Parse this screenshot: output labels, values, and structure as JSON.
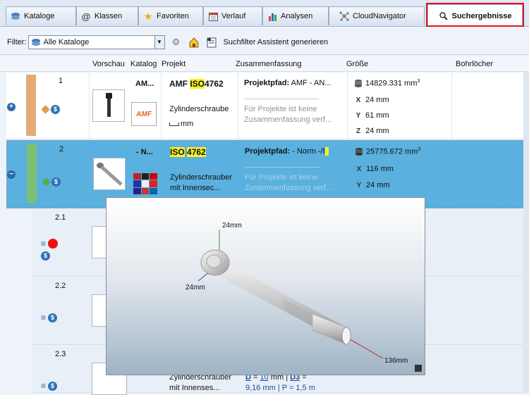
{
  "tabs": [
    {
      "label": "Kataloge",
      "icon": "catalog-stack-icon"
    },
    {
      "label": "Klassen",
      "icon": "at-sign-icon"
    },
    {
      "label": "Favoriten",
      "icon": "star-icon"
    },
    {
      "label": "Verlauf",
      "icon": "calendar-icon"
    },
    {
      "label": "Analysen",
      "icon": "bar-chart-icon"
    },
    {
      "label": "CloudNavigator",
      "icon": "cloud-network-icon"
    },
    {
      "label": "Suchergebnisse",
      "icon": "magnifier-icon",
      "active": true
    }
  ],
  "toolbar": {
    "filter_label": "Filter:",
    "filter_value": "Alle Kataloge",
    "generate_label": "Suchfilter Assistent generieren"
  },
  "columns": {
    "preview": "Vorschau",
    "catalog": "Katalog",
    "project": "Projekt",
    "summary": "Zusammenfassung",
    "size": "Größe",
    "holes": "Bohrlöcher"
  },
  "rows": [
    {
      "index": "1",
      "catalog_short": "AM...",
      "catalog_logo": "AMF",
      "title_prefix": "AMF ",
      "title_hl": "ISO",
      "title_suffix": "4762",
      "description": "Zylinderschraube",
      "unit": "mm",
      "summary_label": "Projektpfad:",
      "summary_value": " AMF - AN...",
      "summary_note1": "Für Projekte ist keine",
      "summary_note2": "Zusammenfassung verf...",
      "volume": "14829.331 mm",
      "volume_sup": "3",
      "dim1": "24 mm",
      "dim2": "61 mm",
      "dim3": "24 mm"
    },
    {
      "index": "2",
      "catalog_short": "- N...",
      "title_hl": "ISO",
      "title_hl2": "4762",
      "description": "Zylinderschrauber",
      "description2": "mit Innensec...",
      "summary_label": "Projektpfad:",
      "summary_value": " - Norm -/I",
      "summary_note1": "Für Projekte ist keine",
      "summary_note2": "Zusammenfassung verf...",
      "volume": "25775.672 mm",
      "volume_sup": "3",
      "dim1": "116 mm",
      "dim2": "24 mm"
    },
    {
      "index": "2.1"
    },
    {
      "index": "2.2"
    },
    {
      "index": "2.3",
      "description": "Zylinderschrauber",
      "description2": "mit Innenses...",
      "partial_D": "D",
      "partial_eq": " = ",
      "partial_10": "10",
      "partial_mm": " mm | ",
      "partial_D3": "D3",
      "partial_eq2": " = ",
      "partial_tail": "9,16 mm | P = 1,5 m"
    }
  ],
  "preview": {
    "dim_top": "24mm",
    "dim_left": "24mm",
    "dim_length": "136mm"
  },
  "colors": {
    "highlight": "#f5f225",
    "selection": "#5ab0de",
    "tab_highlight_border": "#e0161c",
    "bar_row1": "#e3ab78",
    "bar_row2": "#7cbf73"
  }
}
